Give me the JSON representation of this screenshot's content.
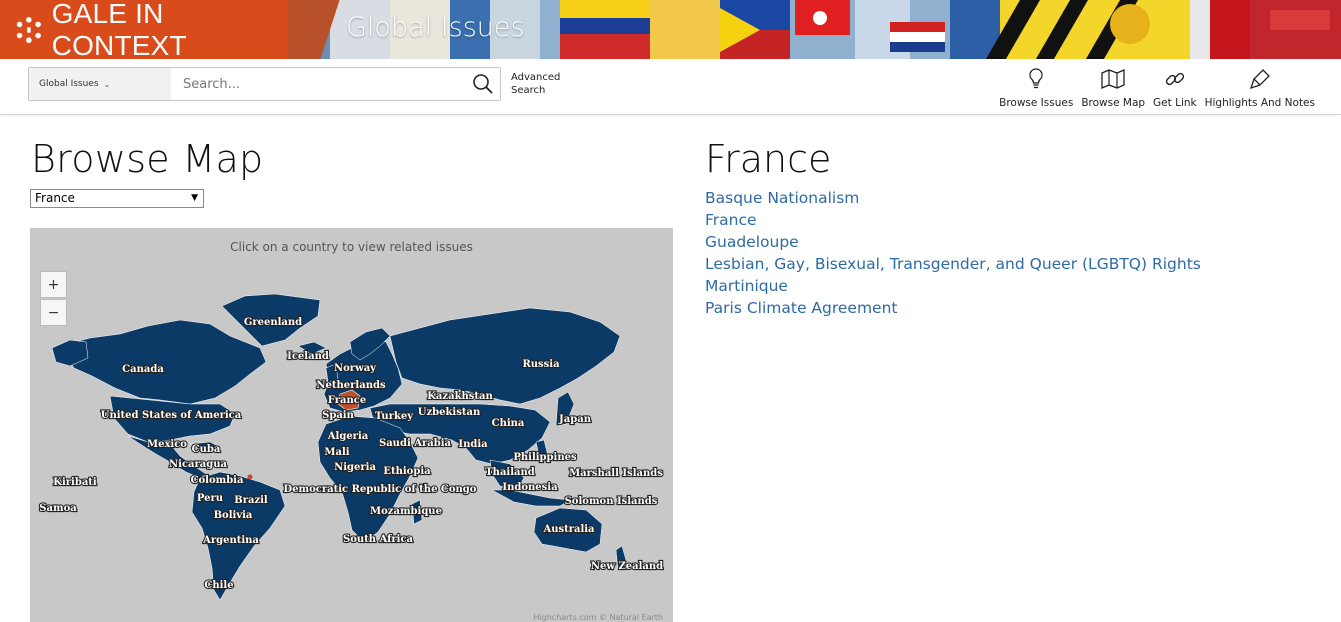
{
  "banner": {
    "brand_name": "GALE IN CONTEXT",
    "product_name": "Global Issues"
  },
  "search": {
    "scope_label": "Global Issues",
    "placeholder": "Search...",
    "advanced_label_line1": "Advanced",
    "advanced_label_line2": "Search"
  },
  "tools": [
    {
      "label": "Browse Issues",
      "icon": "lightbulb-icon"
    },
    {
      "label": "Browse Map",
      "icon": "map-icon"
    },
    {
      "label": "Get Link",
      "icon": "link-icon"
    },
    {
      "label": "Highlights And Notes",
      "icon": "highlighter-icon"
    }
  ],
  "browse_map": {
    "title": "Browse Map",
    "selected_country": "France",
    "map_subtitle": "Click on a country to view related issues",
    "zoom_in": "+",
    "zoom_out": "−",
    "credits": "Highcharts.com © Natural Earth",
    "labels": [
      "Greenland",
      "Iceland",
      "Canada",
      "Norway",
      "Netherlands",
      "France",
      "Spain",
      "United States of America",
      "Turkey",
      "Kazakhstan",
      "Uzbekistan",
      "Russia",
      "China",
      "Japan",
      "Algeria",
      "Saudi Arabia",
      "India",
      "Mexico",
      "Cuba",
      "Mali",
      "Nicaragua",
      "Nigeria",
      "Ethiopia",
      "Philippines",
      "Thailand",
      "Marshall Islands",
      "Colombia",
      "Indonesia",
      "Kiribati",
      "Democratic Republic of the Congo",
      "Peru",
      "Brazil",
      "Solomon Islands",
      "Samoa",
      "Bolivia",
      "Mozambique",
      "Australia",
      "Argentina",
      "South Africa",
      "New Zealand",
      "Chile"
    ]
  },
  "detail": {
    "title": "France",
    "issues": [
      "Basque Nationalism",
      "France",
      "Guadeloupe",
      "Lesbian, Gay, Bisexual, Transgender, and Queer (LGBTQ) Rights",
      "Martinique",
      "Paris Climate Agreement"
    ]
  },
  "colors": {
    "brand": "#d94b1a",
    "land": "#0b3a66",
    "selected": "#c0502a",
    "ocean": "#c8c8c8",
    "link": "#2e6aa6"
  }
}
